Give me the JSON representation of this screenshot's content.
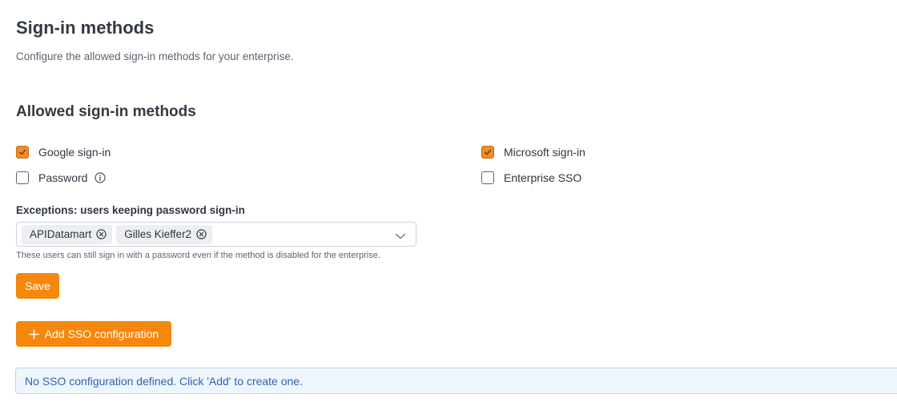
{
  "page": {
    "title": "Sign-in methods",
    "subtitle": "Configure the allowed sign-in methods for your enterprise."
  },
  "allowed_methods": {
    "title": "Allowed sign-in methods",
    "methods": [
      {
        "label": "Google sign-in",
        "checked": true
      },
      {
        "label": "Microsoft sign-in",
        "checked": true
      },
      {
        "label": "Password",
        "checked": false,
        "icon": "info-icon"
      },
      {
        "label": "Enterprise SSO",
        "checked": false
      }
    ]
  },
  "exceptions": {
    "label": "Exceptions: users keeping password sign-in",
    "users": [
      "APIDatamart",
      "Gilles Kieffer2"
    ],
    "helper": "These users can still sign in with a password even if the method is disabled for the enterprise."
  },
  "buttons": {
    "save": "Save",
    "add_sso": "Add SSO configuration"
  },
  "sso_alert": "No SSO configuration defined. Click 'Add' to create one.",
  "colors": {
    "accent": "#f5870d",
    "checkbox_checked": "#f08c2a",
    "info_background": "#eef5fd",
    "info_text": "#2f62b3"
  }
}
